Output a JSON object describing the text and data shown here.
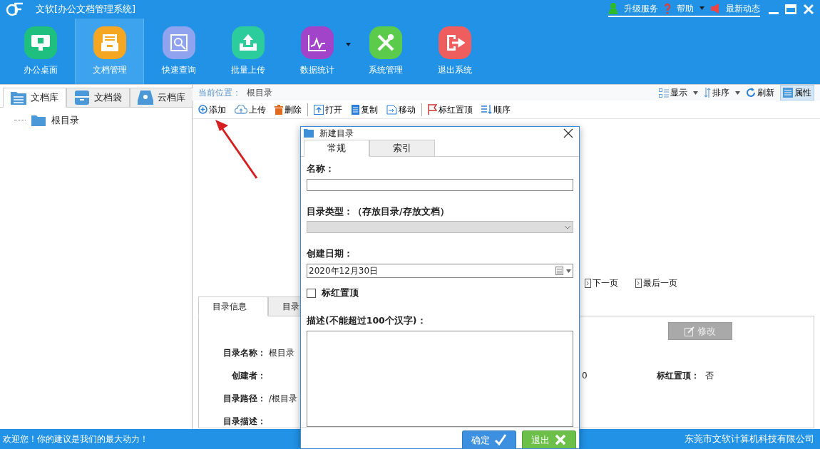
{
  "window": {
    "title": "文软[办公文档管理系统]",
    "links": [
      {
        "label": "升级服务",
        "kind": "upgrade",
        "dropdown": false
      },
      {
        "label": "帮助",
        "kind": "help",
        "dropdown": true
      },
      {
        "label": "最新动态",
        "kind": "news",
        "dropdown": false
      }
    ]
  },
  "nav": [
    {
      "label": "办公桌面",
      "kind": "desktop",
      "color": "#1fbf80",
      "selected": false,
      "dropdown": false
    },
    {
      "label": "文档管理",
      "kind": "files",
      "color": "#f5a623",
      "selected": true,
      "dropdown": false
    },
    {
      "label": "快速查询",
      "kind": "search",
      "color": "#8fa3ef",
      "selected": false,
      "dropdown": false
    },
    {
      "label": "批量上传",
      "kind": "upload",
      "color": "#2dcc9c",
      "selected": false,
      "dropdown": false
    },
    {
      "label": "数据统计",
      "kind": "stats",
      "color": "#a244c9",
      "selected": false,
      "dropdown": true
    },
    {
      "label": "系统管理",
      "kind": "tools",
      "color": "#5bcb4b",
      "selected": false,
      "dropdown": false
    },
    {
      "label": "退出系统",
      "kind": "exit",
      "color": "#ef5e5e",
      "selected": false,
      "dropdown": false
    }
  ],
  "left_tabs": [
    {
      "label": "文档库",
      "kind": "library",
      "selected": true
    },
    {
      "label": "文档袋",
      "kind": "bag",
      "selected": false
    },
    {
      "label": "云档库",
      "kind": "cloud",
      "selected": false
    }
  ],
  "tree": [
    {
      "label": "根目录"
    }
  ],
  "breadcrumb": {
    "label": "当前位置：",
    "value": "根目录"
  },
  "view_tools": [
    {
      "label": "显示",
      "kind": "display",
      "dropdown": true,
      "selected": false
    },
    {
      "label": "排序",
      "kind": "sort",
      "dropdown": true,
      "selected": false
    },
    {
      "label": "刷新",
      "kind": "refresh",
      "dropdown": false,
      "selected": false
    },
    {
      "label": "属性",
      "kind": "props",
      "dropdown": false,
      "selected": true
    }
  ],
  "actions": [
    {
      "label": "添加",
      "kind": "add"
    },
    {
      "label": "上传",
      "kind": "upload"
    },
    {
      "label": "删除",
      "kind": "delete"
    },
    {
      "label": "打开",
      "kind": "open"
    },
    {
      "label": "复制",
      "kind": "copy"
    },
    {
      "label": "移动",
      "kind": "move"
    },
    {
      "label": "标红置顶",
      "kind": "flag"
    },
    {
      "label": "顺序",
      "kind": "order"
    }
  ],
  "pager": [
    "下一页",
    "最后一页"
  ],
  "detail_tabs": [
    {
      "label": "目录信息",
      "selected": true
    },
    {
      "label": "目录",
      "selected": false
    }
  ],
  "details": [
    {
      "label": "目录名称：",
      "value": "根目录"
    },
    {
      "label": "创建者："
    },
    {
      "label": "目录路径：",
      "value": "/根目录"
    },
    {
      "label": "目录描述："
    }
  ],
  "detail_fragment": "0",
  "flag_detail": {
    "label": "标红置顶：",
    "value": "否"
  },
  "edit_button": {
    "label": "修改",
    "disabled": true
  },
  "dialog": {
    "title": "新建目录",
    "tabs": [
      {
        "label": "常规",
        "selected": true
      },
      {
        "label": "索引",
        "selected": false
      }
    ],
    "fields": [
      {
        "kind": "text",
        "label": "名称："
      },
      {
        "kind": "select",
        "label": "目录类型：（存放目录/存放文档）",
        "disabled": true
      },
      {
        "kind": "date",
        "label": "创建日期：",
        "value": "2020年12月30日"
      },
      {
        "kind": "checkbox",
        "label": "标红置顶",
        "checked": false
      },
      {
        "kind": "textarea",
        "label": "描述(不能超过100个汉字)："
      }
    ],
    "buttons": [
      {
        "label": "确定",
        "kind": "ok"
      },
      {
        "label": "退出",
        "kind": "exit"
      }
    ]
  },
  "status_bar": {
    "left": "欢迎您！你的建议是我们的最大动力！",
    "right": "东莞市文软计算机科技有限公司"
  }
}
